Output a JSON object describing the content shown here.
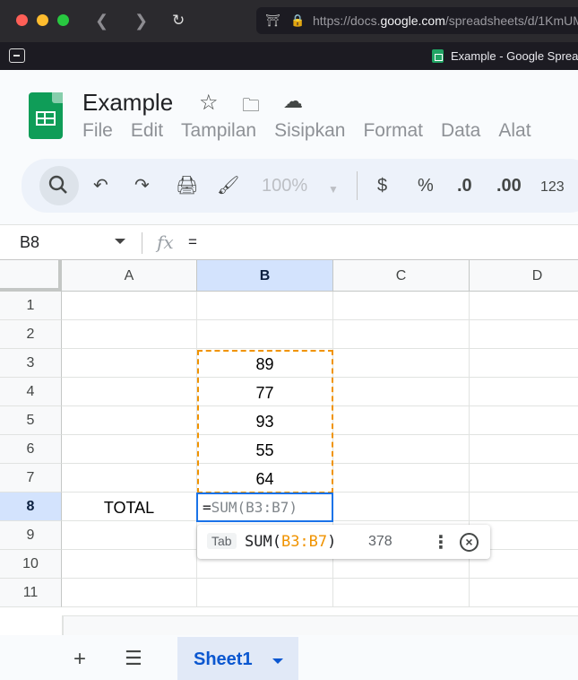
{
  "browser": {
    "url_prefix": "https://docs.",
    "url_domain": "google.com",
    "url_suffix": "/spreadsheets/d/1KmUM",
    "tab_title": "Example - Google Sprea"
  },
  "doc": {
    "title": "Example",
    "menu": [
      "File",
      "Edit",
      "Tampilan",
      "Sisipkan",
      "Format",
      "Data",
      "Alat"
    ]
  },
  "toolbar": {
    "zoom": "100%",
    "currency": "$",
    "percent": "%",
    "dec_decrease": ".0",
    "dec_increase": ".00",
    "number_format": "123"
  },
  "formula_bar": {
    "name_box": "B8",
    "fx": "fx",
    "value": "="
  },
  "columns": [
    "A",
    "B",
    "C",
    "D"
  ],
  "rows": [
    "1",
    "2",
    "3",
    "4",
    "5",
    "6",
    "7",
    "8",
    "9",
    "10",
    "11"
  ],
  "cells": {
    "B3": "89",
    "B4": "77",
    "B5": "93",
    "B6": "55",
    "B7": "64",
    "A8": "TOTAL"
  },
  "active_cell": {
    "prefix": "=",
    "placeholder": "SUM(B3:B7)"
  },
  "hint": {
    "tab_key": "Tab",
    "fn_open": "SUM(",
    "fn_range": "B3:B7",
    "fn_close": ")",
    "result": "378"
  },
  "bottom": {
    "sheet_name": "Sheet1"
  }
}
